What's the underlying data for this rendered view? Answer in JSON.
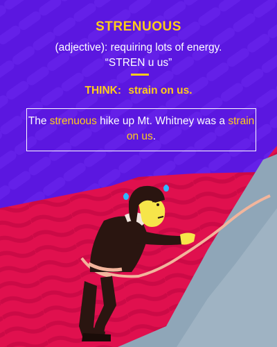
{
  "word": "STRENUOUS",
  "definition": {
    "part_of_speech": "(adjective):",
    "meaning": "requiring lots of energy.",
    "pronunciation": "“STREN u us”"
  },
  "think": {
    "label": "THINK:",
    "mnemonic": "strain on us."
  },
  "example": {
    "before": "The ",
    "highlight_word": "strenuous",
    "middle": " hike up Mt. Whitney was a ",
    "highlight_phrase": "strain on us",
    "after": "."
  },
  "colors": {
    "background": "#5b17e0",
    "accent": "#ffcc1a",
    "text": "#ffffff",
    "mountain_far": "#e0104e",
    "mountain_near": "#8fa6b8",
    "rope": "#f2b59c"
  },
  "illustration": "hiker-climbing-mountain"
}
